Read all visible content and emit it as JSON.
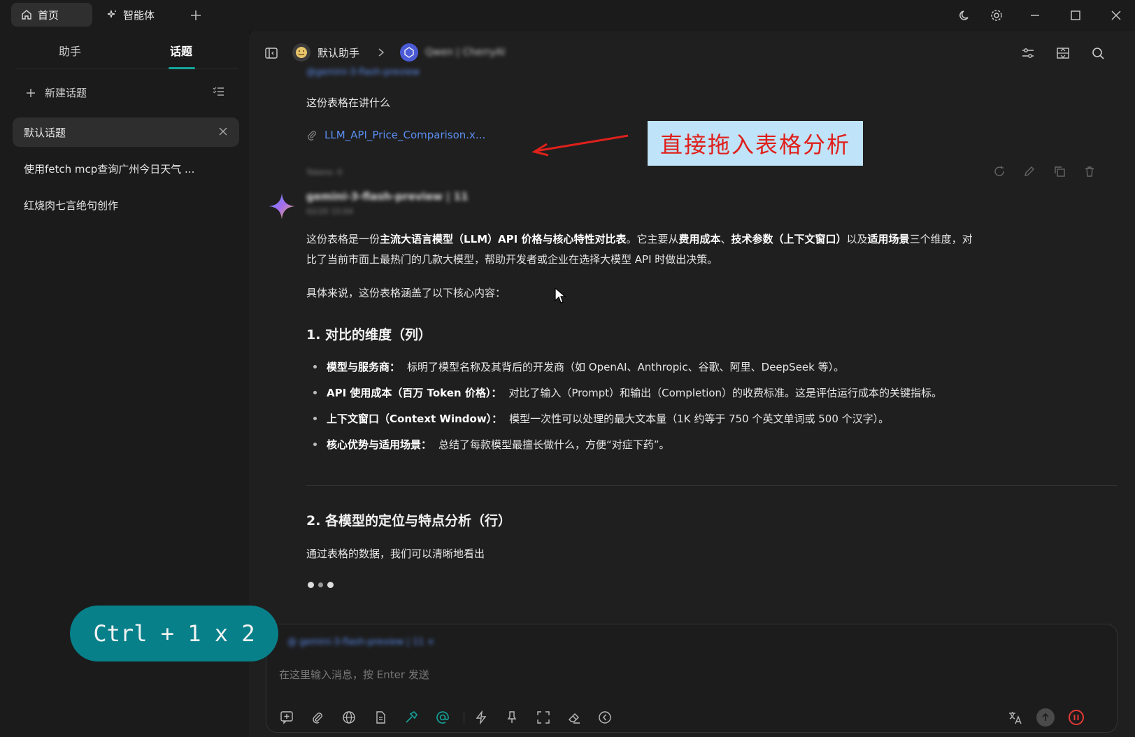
{
  "titlebar": {
    "tabs": [
      {
        "label": "首页",
        "icon": "home-icon"
      },
      {
        "label": "智能体",
        "icon": "sparkle-icon"
      }
    ]
  },
  "sidebar": {
    "tabs": [
      {
        "label": "助手"
      },
      {
        "label": "话题"
      }
    ],
    "new_topic_label": "新建话题",
    "topics": [
      {
        "label": "默认话题"
      },
      {
        "label": "使用fetch mcp查询广州今日天气 ..."
      },
      {
        "label": "红烧肉七言绝句创作"
      }
    ]
  },
  "header": {
    "assistant_name": "默认助手",
    "model_name": "Qwen | CherryAI"
  },
  "conversation": {
    "user_message": "这份表格在讲什么",
    "attachment_name": "LLM_API_Price_Comparison.x...",
    "tokens_label": "Tokens: 0",
    "model_meta": "gemini-3-flash-preview | 11",
    "timestamp": "02/20 15:04",
    "top_blur": "@gemini-3-flash-preview",
    "reply": {
      "p1_a": "这份表格是一份",
      "p1_b": "主流大语言模型（LLM）API 价格与核心特性对比表",
      "p1_c": "。它主要从",
      "p1_d": "费用成本",
      "p1_e": "、",
      "p1_f": "技术参数（上下文窗口）",
      "p1_g": "以及",
      "p1_h": "适用场景",
      "p1_i": "三个维度，对",
      "p1_line2": "比了当前市面上最热门的几款大模型，帮助开发者或企业在选择大模型 API 时做出决策。",
      "p2": "具体来说，这份表格涵盖了以下核心内容：",
      "h1": "1. 对比的维度（列）",
      "bullets": [
        {
          "title": "模型与服务商：",
          "text": "标明了模型名称及其背后的开发商（如 OpenAI、Anthropic、谷歌、阿里、DeepSeek 等）。"
        },
        {
          "title": "API 使用成本（百万 Token 价格）：",
          "text": "对比了输入（Prompt）和输出（Completion）的收费标准。这是评估运行成本的关键指标。"
        },
        {
          "title": "上下文窗口（Context Window）：",
          "text": "模型一次性可以处理的最大文本量（1K 约等于 750 个英文单词或 500 个汉字）。"
        },
        {
          "title": "核心优势与适用场景：",
          "text": "总结了每款模型最擅长做什么，方便“对症下药”。"
        }
      ],
      "h2": "2. 各模型的定位与特点分析（行）",
      "p3": "通过表格的数据，我们可以清晰地看出"
    }
  },
  "input": {
    "mention_chip": "@ gemini-3-flash-preview | 11 ×",
    "placeholder": "在这里输入消息，按 Enter 发送"
  },
  "overlays": {
    "callout": "直接拖入表格分析",
    "shortcut": "Ctrl + 1 x 2"
  },
  "colors": {
    "accent": "#14a59a",
    "link": "#5b8def",
    "callout_bg": "#bfe3f8",
    "callout_text": "#e0201b",
    "shortcut_bg": "#07808a",
    "stop": "#e53935"
  }
}
